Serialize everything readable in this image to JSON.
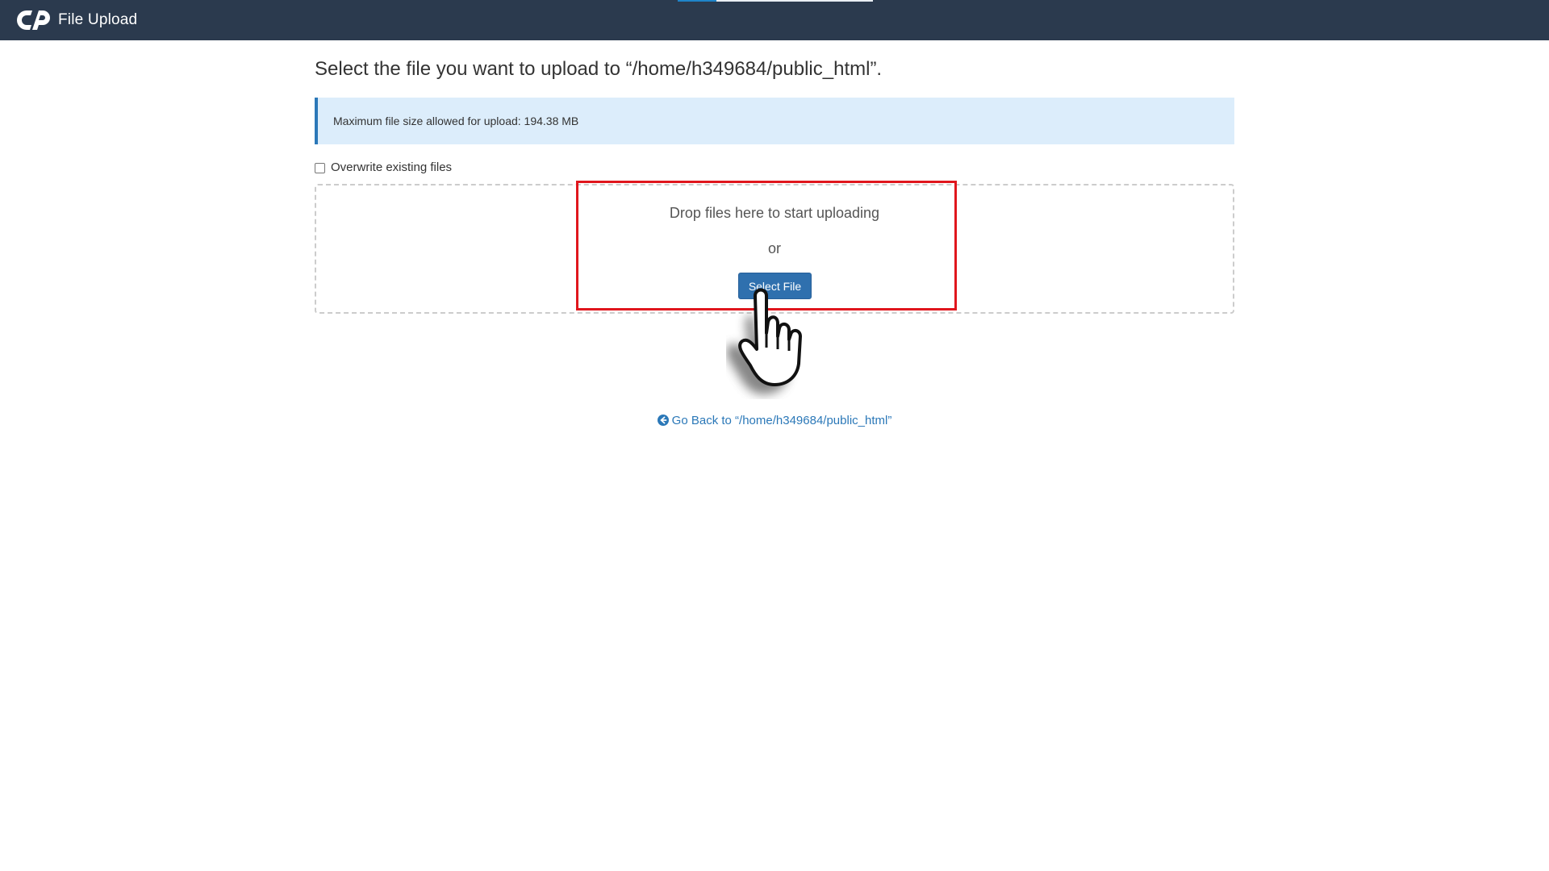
{
  "header": {
    "app_title": "File Upload",
    "logo_icon": "cpanel-logo-icon"
  },
  "main": {
    "title": "Select the file you want to upload to “/home/h349684/public_html”.",
    "info": "Maximum file size allowed for upload: 194.38 MB",
    "overwrite_label": "Overwrite existing files",
    "overwrite_checked": false,
    "dropzone": {
      "drop_text": "Drop files here to start uploading",
      "or_text": "or",
      "select_button_label": "Select File"
    },
    "go_back_label": "Go Back to “/home/h349684/public_html”",
    "go_back_icon": "arrow-circle-left-icon"
  },
  "colors": {
    "topbar": "#2b3a4e",
    "accent": "#2f70ae",
    "info_bg": "#dcedfb",
    "highlight": "#e0161d"
  }
}
